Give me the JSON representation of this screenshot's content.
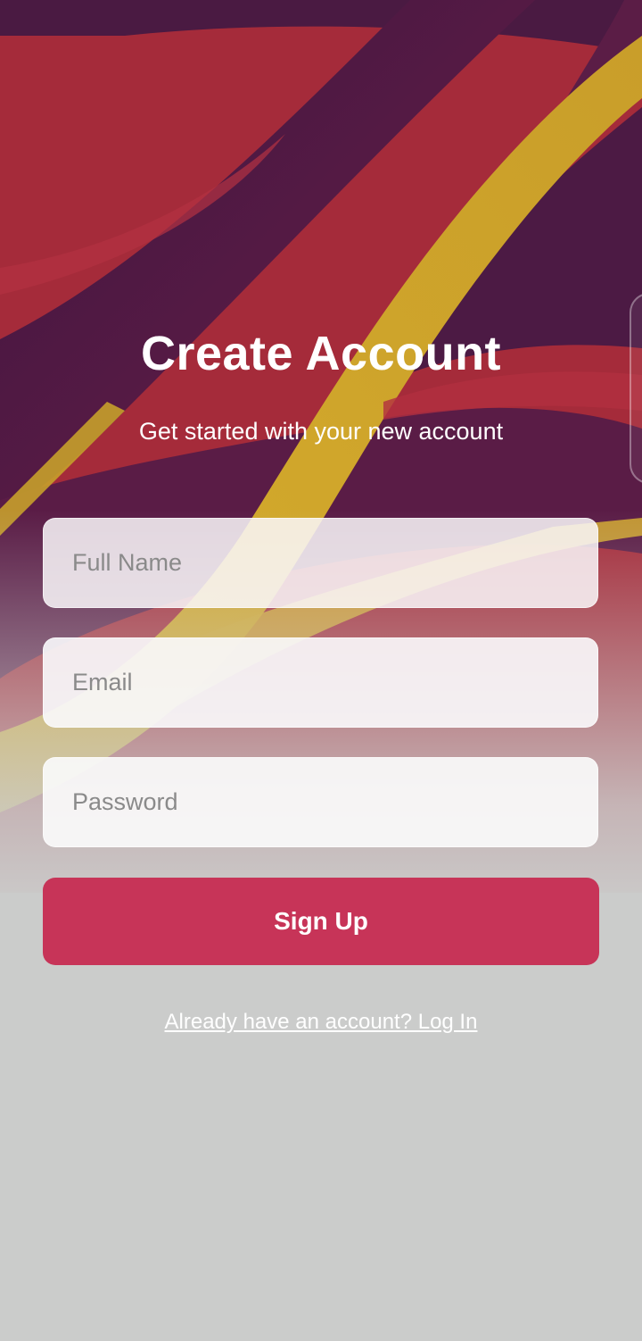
{
  "header": {
    "title": "Create Account",
    "subtitle": "Get started with your new account"
  },
  "form": {
    "full_name": {
      "placeholder": "Full Name",
      "value": ""
    },
    "email": {
      "placeholder": "Email",
      "value": ""
    },
    "password": {
      "placeholder": "Password",
      "value": ""
    },
    "submit_label": "Sign Up"
  },
  "footer": {
    "login_link": "Already have an account? Log In"
  },
  "colors": {
    "accent": "#c73458",
    "background_grey": "#cbcccb",
    "wave_red": "#a52a3c",
    "wave_purple": "#4e1a45",
    "wave_gold": "#c9a62c"
  },
  "icons": [
    "background-wave-art",
    "side-handle"
  ]
}
